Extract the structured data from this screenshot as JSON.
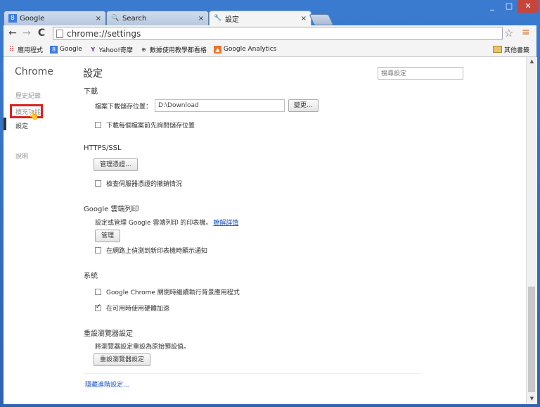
{
  "tabs": [
    {
      "label": "Google",
      "icon": "google-g-icon",
      "close": "×"
    },
    {
      "label": "Search",
      "icon": "search-icon",
      "close": "×"
    },
    {
      "label": "設定",
      "icon": "wrench-icon",
      "close": "×",
      "active": true
    }
  ],
  "window_controls": {
    "minimize": "_",
    "maximize": "□",
    "close": "✕"
  },
  "toolbar": {
    "back": "←",
    "forward": "→",
    "reload": "C",
    "url": "chrome://settings",
    "star": "☆",
    "menu": "≡"
  },
  "bookmarks": {
    "items": [
      "應用程式",
      "Google",
      "Yahoo!奇摩",
      "數據使用教學都看格",
      "Google Analytics"
    ],
    "other": "其他書籤"
  },
  "sidebar": {
    "title": "Chrome",
    "items": [
      "歷史紀錄",
      "擴充功能",
      "設定",
      "說明"
    ],
    "active_index": 2,
    "highlighted_index": 1
  },
  "main": {
    "title": "設定",
    "search_placeholder": "搜尋設定",
    "sections": {
      "download": {
        "title": "下載",
        "location_label": "檔案下載儲存位置：",
        "location_value": "D:\\Download",
        "browse_label": "變更...",
        "ask_label": "下載每個檔案前先詢問儲存位置",
        "ask_checked": false
      },
      "https": {
        "title": "HTTPS/SSL",
        "manage_label": "管理憑證...",
        "revocation_label": "檢查伺服器憑證的撤銷情況",
        "revocation_checked": false
      },
      "cloud_print": {
        "title": "Google 雲端列印",
        "desc": "設定或管理 Google 雲端列印 的印表機。",
        "learn_more": "瞭解詳情",
        "manage_label": "管理",
        "notify_label": "在網路上偵測到新印表機時顯示通知",
        "notify_checked": false
      },
      "system": {
        "title": "系統",
        "background_label": "Google Chrome 關閉時繼續執行背景應用程式",
        "background_checked": false,
        "hw_accel_label": "在可用時使用硬體加速",
        "hw_accel_checked": true
      },
      "reset": {
        "title": "重設瀏覽器設定",
        "desc": "將瀏覽器設定重設為原始預設值。",
        "button_label": "重設瀏覽器設定"
      }
    },
    "hide_advanced": "隱藏進階設定..."
  }
}
